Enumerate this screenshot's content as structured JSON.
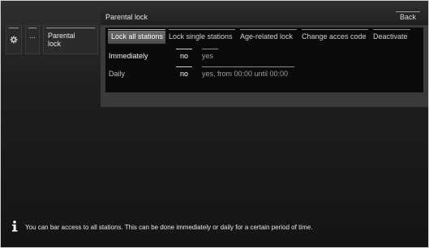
{
  "sidebar": {
    "gear_icon": "gear-icon",
    "more_label": "...",
    "parental_label_line1": "Parental",
    "parental_label_line2": "lock"
  },
  "panel": {
    "title": "Parental lock",
    "back_label": "Back",
    "tabs": [
      {
        "label": "Lock all stations",
        "active": true
      },
      {
        "label": "Lock single stations",
        "active": false
      },
      {
        "label": "Age-related lock",
        "active": false
      },
      {
        "label": "Change acces code",
        "active": false
      },
      {
        "label": "Deactivate",
        "active": false
      }
    ],
    "rows": [
      {
        "label": "Immediately",
        "selected": "no",
        "other": "yes"
      },
      {
        "label": "Daily",
        "selected": "no",
        "other": "yes, from 00:00 until 00:00"
      }
    ]
  },
  "info": {
    "icon": "info-icon",
    "text": "You can bar access to all stations. This can be done immediately or daily for a certain period of time."
  }
}
